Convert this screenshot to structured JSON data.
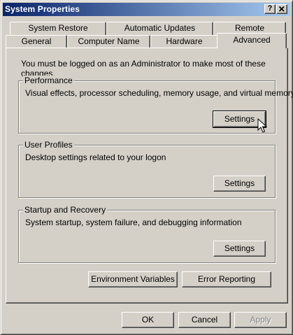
{
  "window": {
    "title": "System Properties",
    "help_label": "?",
    "close_label": "x"
  },
  "tabs": {
    "row_back": [
      {
        "label": "System Restore"
      },
      {
        "label": "Automatic Updates"
      },
      {
        "label": "Remote"
      }
    ],
    "row_front": [
      {
        "label": "General"
      },
      {
        "label": "Computer Name"
      },
      {
        "label": "Hardware"
      },
      {
        "label": "Advanced",
        "active": true
      }
    ]
  },
  "advanced": {
    "intro": "You must be logged on as an Administrator to make most of these changes.",
    "performance": {
      "title": "Performance",
      "description": "Visual effects, processor scheduling, memory usage, and virtual memory",
      "button": "Settings"
    },
    "user_profiles": {
      "title": "User Profiles",
      "description": "Desktop settings related to your logon",
      "button": "Settings"
    },
    "startup_recovery": {
      "title": "Startup and Recovery",
      "description": "System startup, system failure, and debugging information",
      "button": "Settings"
    },
    "environment_variables": "Environment Variables",
    "error_reporting": "Error Reporting"
  },
  "footer": {
    "ok": "OK",
    "cancel": "Cancel",
    "apply": "Apply"
  }
}
